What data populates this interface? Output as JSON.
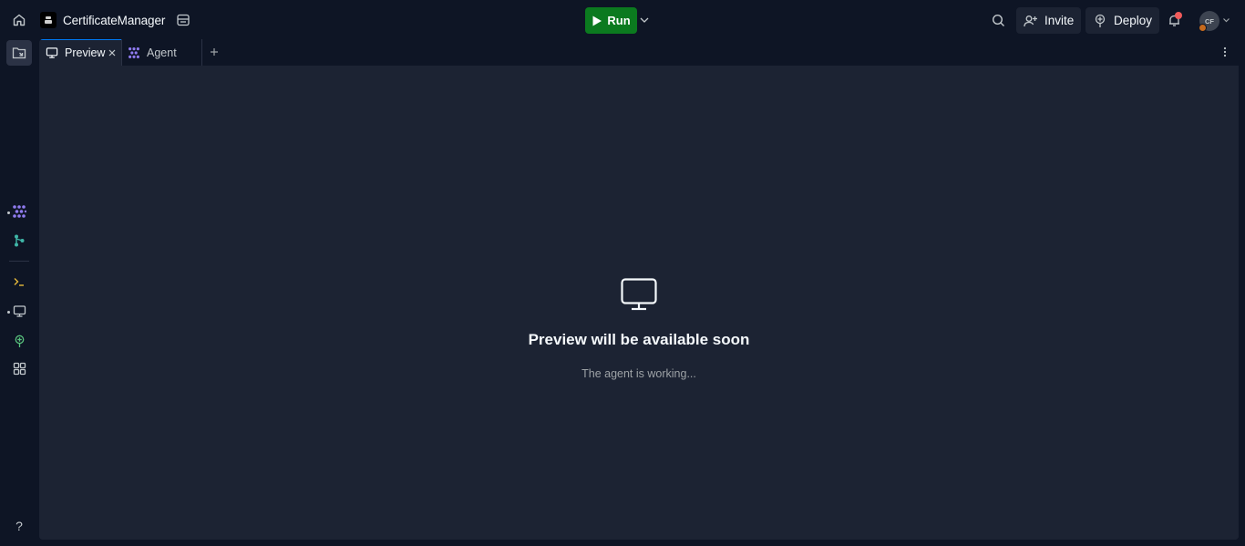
{
  "topbar": {
    "home_icon": "home-icon",
    "repl_name": "CertificateManager",
    "run_label": "Run",
    "invite_label": "Invite",
    "deploy_label": "Deploy",
    "user_initials": "CF"
  },
  "tabs": [
    {
      "label": "Preview",
      "icon": "monitor-icon",
      "active": true
    },
    {
      "label": "Agent",
      "icon": "agent-icon",
      "active": false
    }
  ],
  "preview": {
    "title": "Preview will be available soon",
    "subtitle": "The agent is working..."
  },
  "sidebar": {
    "help_label": "?"
  },
  "colors": {
    "background": "#0e1525",
    "panel": "#1c2333",
    "run_green": "#0b7a1f",
    "agent_purple": "#8f7bf0",
    "git_teal": "#3fb6a8",
    "deploy_green": "#58c27d",
    "notification_red": "#f25b5b"
  }
}
